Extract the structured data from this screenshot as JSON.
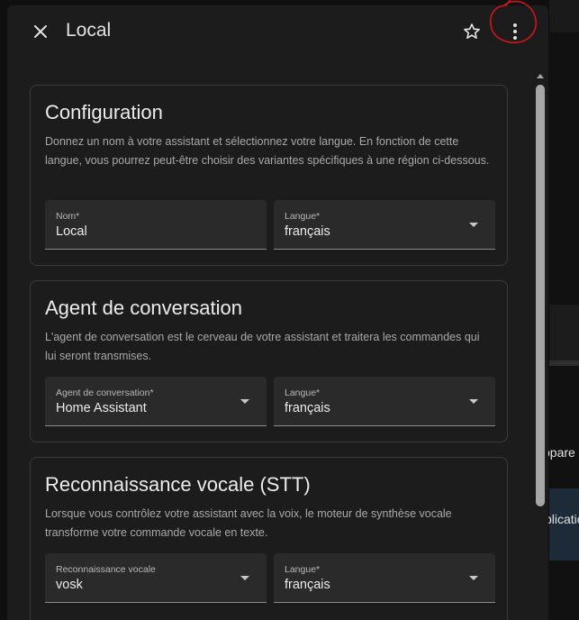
{
  "background": {
    "text_fragment_1": "ppare",
    "text_fragment_2": "plicatio"
  },
  "dialog": {
    "title": "Local",
    "icons": {
      "close": "close-icon",
      "favorite": "star-outline-icon",
      "more": "dots-vertical-icon"
    },
    "annotation_color": "#d0161b"
  },
  "sections": [
    {
      "title": "Configuration",
      "description": "Donnez un nom à votre assistant et sélectionnez votre langue. En fonction de cette langue, vous pourrez peut-être choisir des variantes spécifiques à une région ci-dessous.",
      "fields": [
        {
          "label": "Nom*",
          "value": "Local",
          "type": "text"
        },
        {
          "label": "Langue*",
          "value": "français",
          "type": "select"
        }
      ]
    },
    {
      "title": "Agent de conversation",
      "description": "L'agent de conversation est le cerveau de votre assistant et traitera les commandes qui lui seront transmises.",
      "fields": [
        {
          "label": "Agent de conversation*",
          "value": "Home Assistant",
          "type": "select"
        },
        {
          "label": "Langue*",
          "value": "français",
          "type": "select"
        }
      ]
    },
    {
      "title": "Reconnaissance vocale (STT)",
      "description": "Lorsque vous contrôlez votre assistant avec la voix, le moteur de synthèse vocale transforme votre commande vocale en texte.",
      "fields": [
        {
          "label": "Reconnaissance vocale",
          "value": "vosk",
          "type": "select"
        },
        {
          "label": "Langue*",
          "value": "français",
          "type": "select"
        }
      ]
    }
  ],
  "colors": {
    "dialog_bg": "#1c1c1c",
    "field_bg": "#2a2a2a",
    "card_border": "#3a3a3a",
    "text_primary": "#e1e1e1",
    "text_secondary": "#a9a9a9"
  }
}
